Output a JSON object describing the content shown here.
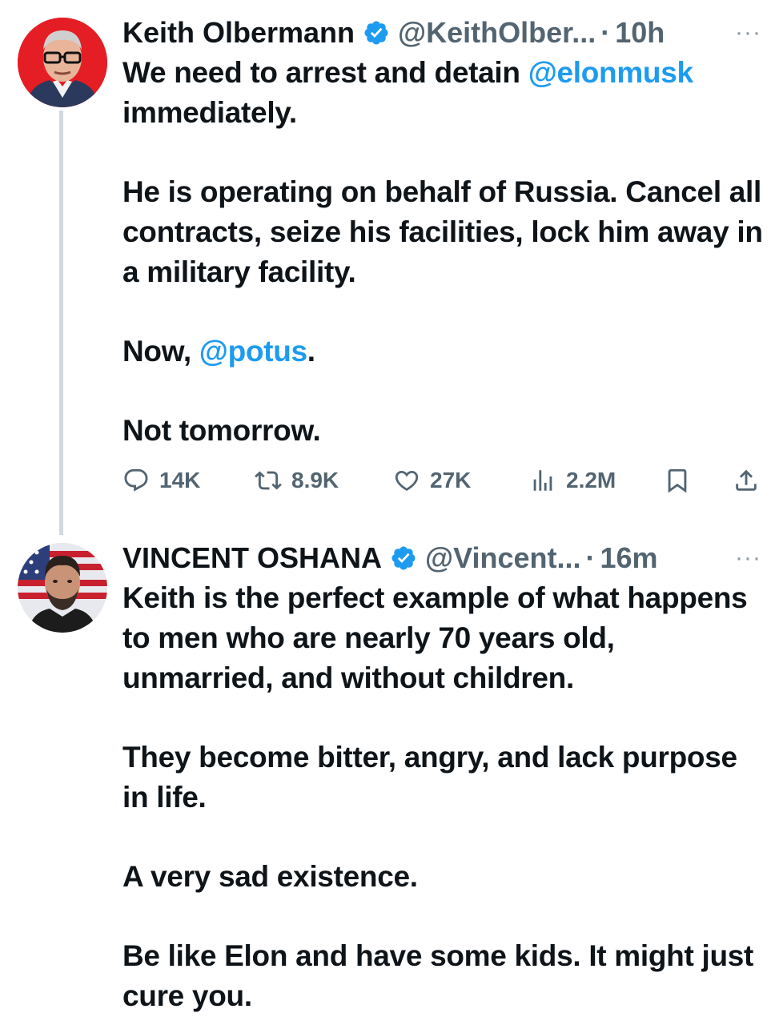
{
  "tweets": [
    {
      "author_name": "Keith Olbermann",
      "handle": "@KeithOlber...",
      "separator": "·",
      "time": "10h",
      "more_label": "···",
      "body": {
        "p1_a": "We need to arrest and detain ",
        "p1_mention": "@elonmusk",
        "p1_b": " immediately.",
        "p2": "He is operating on behalf of Russia. Cancel all contracts, seize his facilities, lock him away in a military facility.",
        "p3_a": "Now, ",
        "p3_mention": "@potus",
        "p3_b": ".",
        "p4": "Not tomorrow."
      },
      "stats": {
        "replies": "14K",
        "reposts": "8.9K",
        "likes": "27K",
        "views": "2.2M"
      },
      "icons": [
        "reply-icon",
        "retweet-icon",
        "heart-icon",
        "views-icon",
        "bookmark-icon",
        "share-icon"
      ]
    },
    {
      "author_name": "VINCENT OSHANA",
      "handle": "@Vincent...",
      "separator": "·",
      "time": "16m",
      "more_label": "···",
      "body": {
        "p1": "Keith is the perfect example of what happens to men who are nearly 70 years old, unmarried, and without children.",
        "p2": "They become bitter, angry, and lack purpose in life.",
        "p3": "A very sad existence.",
        "p4": "Be like Elon and have some kids. It might just cure you."
      }
    }
  ],
  "colors": {
    "text": "#0f1419",
    "secondary": "#536471",
    "link": "#1d9bf0",
    "verified": "#1d9bf0",
    "thread_line": "#cfd9de"
  }
}
